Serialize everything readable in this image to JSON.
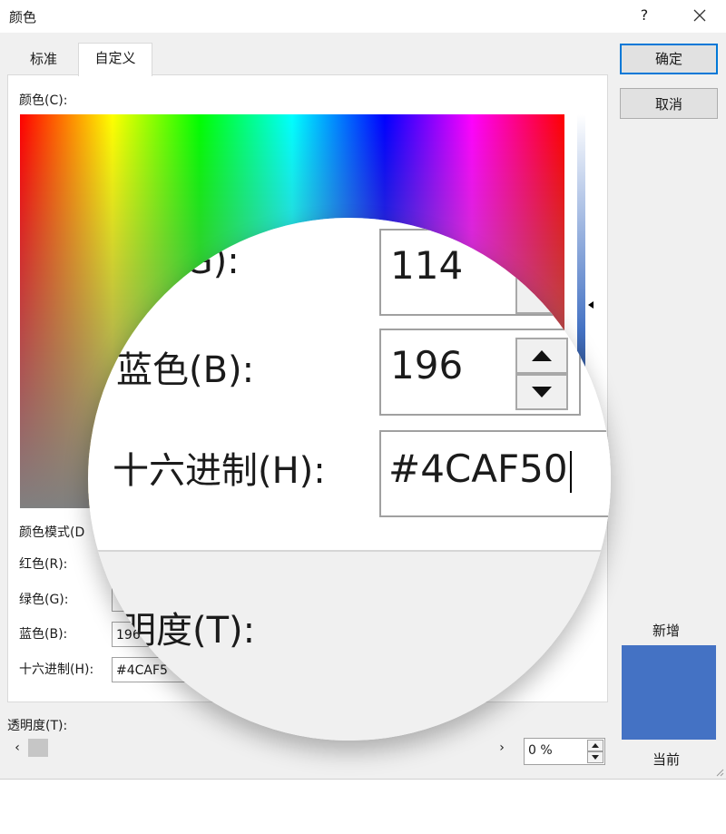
{
  "window": {
    "title": "颜色",
    "help": "?",
    "close_icon": "close-icon"
  },
  "tabs": [
    {
      "label": "标准"
    },
    {
      "label": "自定义"
    }
  ],
  "labels": {
    "colors": "颜色(C):",
    "color_mode": "颜色模式(D",
    "red": "红色(R):",
    "green": "绿色(G):",
    "blue": "蓝色(B):",
    "hex": "十六进制(H):",
    "transparency": "透明度(T):"
  },
  "values": {
    "blue_partial": "196",
    "hex_partial": "#4CAF5"
  },
  "buttons": {
    "ok": "确定",
    "cancel": "取消"
  },
  "preview": {
    "new_label": "新增",
    "current_label": "当前",
    "color": "#4472c4"
  },
  "transparency": {
    "value": "0 %",
    "slider_fraction": 0
  },
  "magnifier": {
    "green_label": "(G):",
    "green_value": "114",
    "blue_label": "蓝色(B):",
    "blue_value": "196",
    "hex_label": "十六进制(H):",
    "hex_value": "#4CAF50",
    "transparency_label": "明度(T):"
  }
}
